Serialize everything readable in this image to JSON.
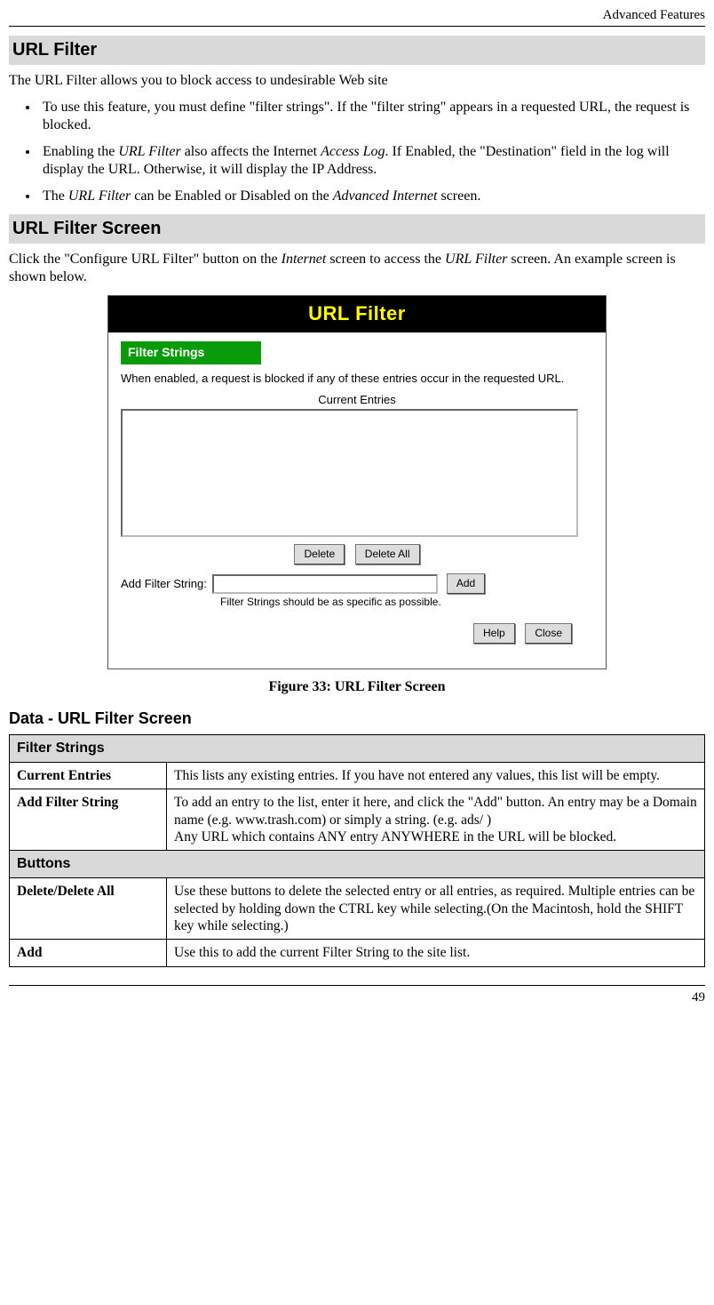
{
  "header": {
    "right": "Advanced Features"
  },
  "s1": {
    "title": "URL Filter",
    "intro": "The URL Filter allows you to block access to undesirable Web site",
    "b1a": "To use this feature, you must define \"filter strings\". If the \"filter string\" appears in a requested URL, the request is blocked.",
    "b2pre": "Enabling the ",
    "b2i1": "URL Filter",
    "b2mid": " also affects the Internet ",
    "b2i2": "Access Log",
    "b2post": ". If Enabled, the \"Destination\" field in the log will display the URL. Otherwise, it will display the IP Address.",
    "b3pre": "The ",
    "b3i1": "URL Filter",
    "b3mid": " can be Enabled or Disabled on the ",
    "b3i2": "Advanced Internet",
    "b3post": " screen."
  },
  "s2": {
    "title": "URL Filter Screen",
    "p_pre": "Click the \"Configure URL Filter\" button on the ",
    "p_i1": "Internet",
    "p_mid": " screen to access the ",
    "p_i2": "URL Filter",
    "p_post": " screen. An example screen is shown below."
  },
  "shot": {
    "title": "URL Filter",
    "section": "Filter Strings",
    "desc": "When enabled, a request is blocked if any of these entries occur in the requested URL.",
    "current": "Current Entries",
    "delete": "Delete",
    "delete_all": "Delete All",
    "add_label": "Add Filter String:",
    "add_btn": "Add",
    "hint": "Filter Strings should be as specific as possible.",
    "help": "Help",
    "close": "Close"
  },
  "caption": "Figure 33: URL Filter Screen",
  "s3": {
    "title": "Data - URL Filter Screen"
  },
  "table": {
    "cat1": "Filter Strings",
    "r1k": "Current Entries",
    "r1v": "This lists any existing entries. If you have not entered any values, this list will be empty.",
    "r2k": "Add Filter String",
    "r2v": "To add an entry to the list, enter it here, and click the \"Add\" button. An entry may be a Domain name (e.g. www.trash.com) or simply a string. (e.g. ads/ )\nAny URL which contains ANY entry ANYWHERE in the URL will be blocked.",
    "cat2": "Buttons",
    "r3k": "Delete/Delete All",
    "r3v": "Use these buttons to delete the selected entry or all entries, as required. Multiple entries can be selected by holding down the CTRL key while selecting.(On the Macintosh, hold the SHIFT key while selecting.)",
    "r4k": "Add",
    "r4v": "Use this to add the current Filter String to the site list."
  },
  "page": "49"
}
